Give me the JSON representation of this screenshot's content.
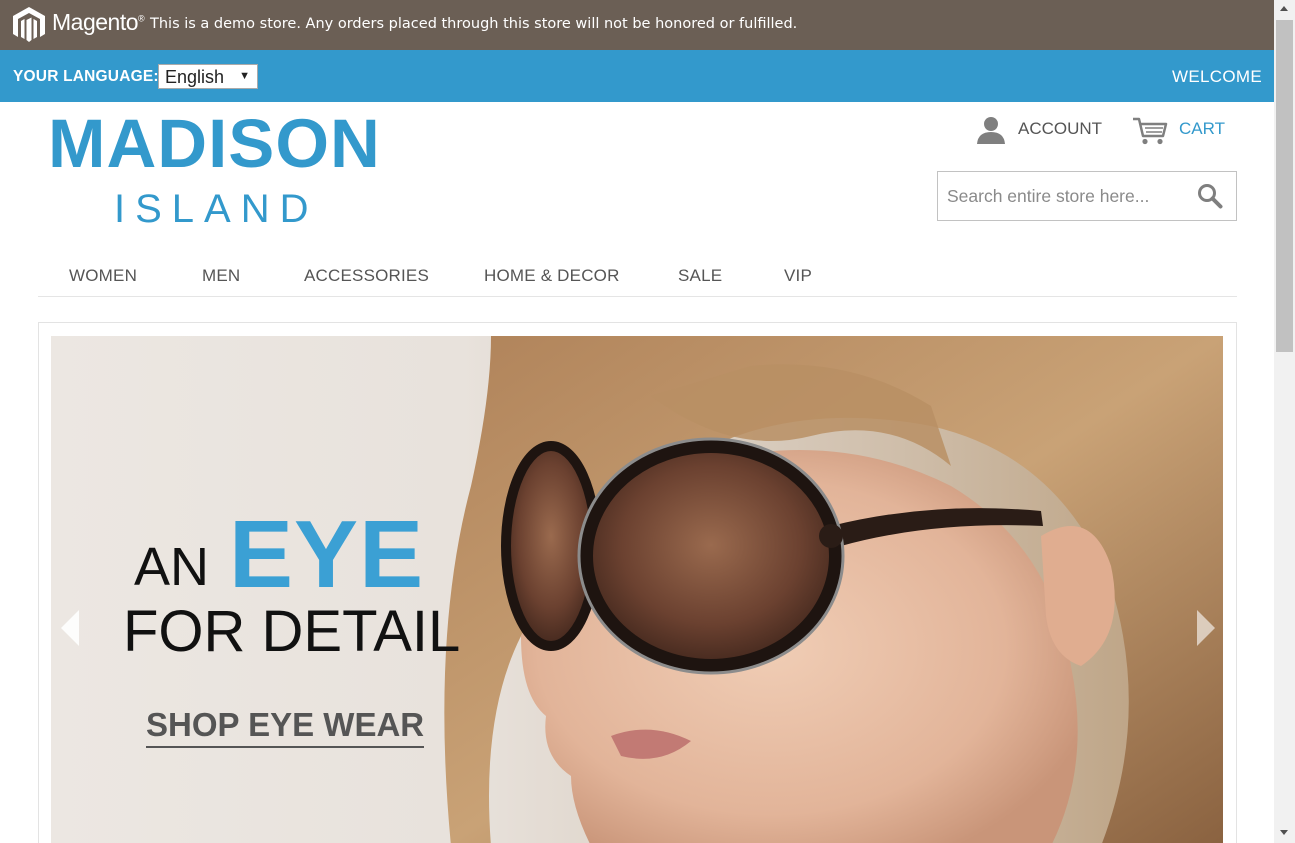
{
  "demo_bar": {
    "brand": "Magento",
    "trademark": "®",
    "notice": "This is a demo store. Any orders placed through this store will not be honored or fulfilled."
  },
  "language_bar": {
    "label": "YOUR LANGUAGE:",
    "selected_language": "English",
    "welcome": "WELCOME"
  },
  "header": {
    "logo_main": "MADISON",
    "logo_sub": "ISLAND",
    "account_label": "ACCOUNT",
    "cart_label": "CART",
    "search_placeholder": "Search entire store here...",
    "search_value": ""
  },
  "nav": {
    "items": [
      {
        "label": "WOMEN"
      },
      {
        "label": "MEN"
      },
      {
        "label": "ACCESSORIES"
      },
      {
        "label": "HOME & DECOR"
      },
      {
        "label": "SALE"
      },
      {
        "label": "VIP"
      }
    ]
  },
  "banner": {
    "headline_an": "AN",
    "headline_eye": "EYE",
    "headline_detail": "FOR DETAIL",
    "cta": "SHOP EYE WEAR"
  },
  "colors": {
    "demo_bar": "#6b5f55",
    "accent": "#3399cc",
    "text_dark": "#555555"
  },
  "icons": [
    "magento-logo-icon",
    "dropdown-arrow-icon",
    "account-icon",
    "cart-icon",
    "search-icon",
    "chevron-left-icon",
    "chevron-right-icon"
  ]
}
